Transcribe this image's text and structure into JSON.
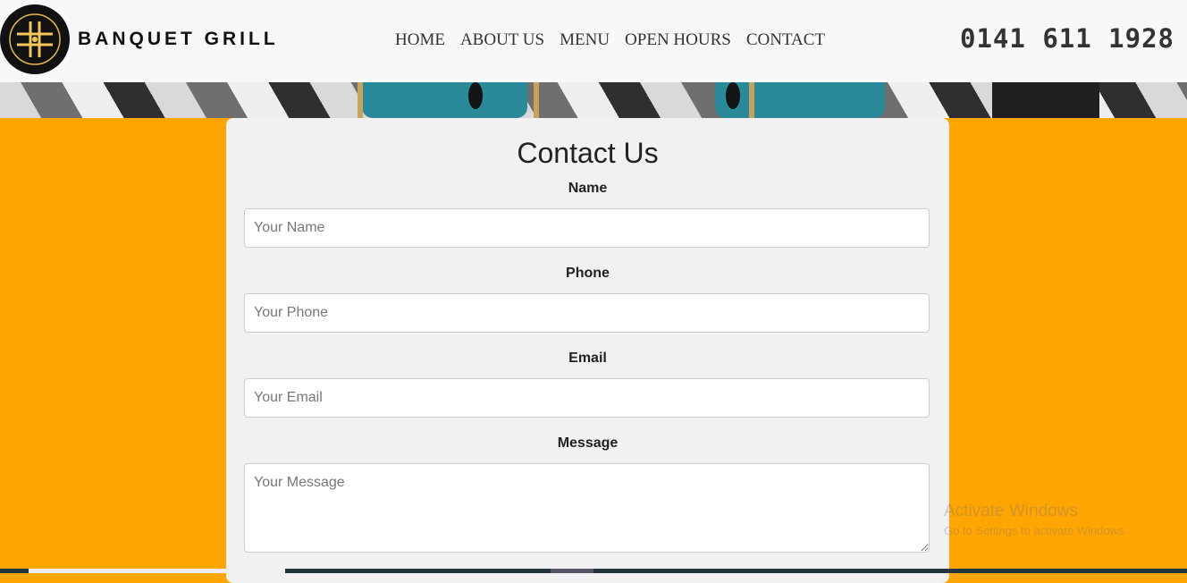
{
  "header": {
    "brand": "BANQUET GRILL",
    "phone": "0141 611 1928",
    "nav": [
      "HOME",
      "ABOUT US",
      "MENU",
      "OPEN HOURS",
      "CONTACT"
    ]
  },
  "contact_form": {
    "title": "Contact Us",
    "name_label": "Name",
    "name_placeholder": "Your Name",
    "phone_label": "Phone",
    "phone_placeholder": "Your Phone",
    "email_label": "Email",
    "email_placeholder": "Your Email",
    "message_label": "Message",
    "message_placeholder": "Your Message"
  },
  "watermark": {
    "line1": "Activate Windows",
    "line2": "Go to Settings to activate Windows."
  },
  "colors": {
    "page_background": "#ffa500",
    "header_background": "#f7f8f9",
    "card_background": "#f1f1f1"
  },
  "icons": {
    "logo": "fork-knife-logo-icon"
  }
}
